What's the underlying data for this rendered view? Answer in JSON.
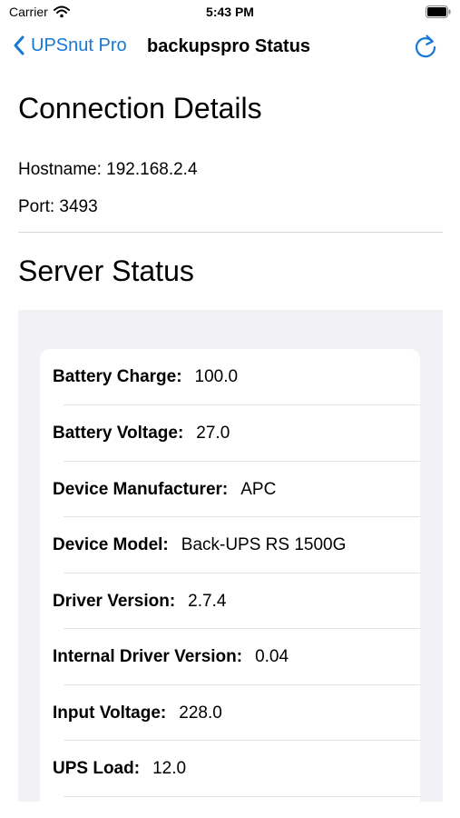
{
  "status_bar": {
    "carrier": "Carrier",
    "time": "5:43 PM",
    "icons": [
      "wifi-icon",
      "battery-icon"
    ]
  },
  "nav": {
    "back_label": "UPSnut Pro",
    "title": "backupspro Status",
    "refresh_icon": "refresh-icon",
    "accent_color": "#1478d6"
  },
  "connection": {
    "heading": "Connection Details",
    "hostname_line": "Hostname: 192.168.2.4",
    "port_line": "Port: 3493"
  },
  "server": {
    "heading": "Server Status",
    "rows": [
      {
        "label": "Battery Charge:",
        "value": "100.0"
      },
      {
        "label": "Battery Voltage:",
        "value": "27.0"
      },
      {
        "label": "Device Manufacturer:",
        "value": "APC"
      },
      {
        "label": "Device Model:",
        "value": "Back-UPS RS 1500G"
      },
      {
        "label": "Driver Version:",
        "value": "2.7.4"
      },
      {
        "label": "Internal Driver Version:",
        "value": "0.04"
      },
      {
        "label": "Input Voltage:",
        "value": "228.0"
      },
      {
        "label": "UPS Load:",
        "value": "12.0"
      }
    ]
  }
}
